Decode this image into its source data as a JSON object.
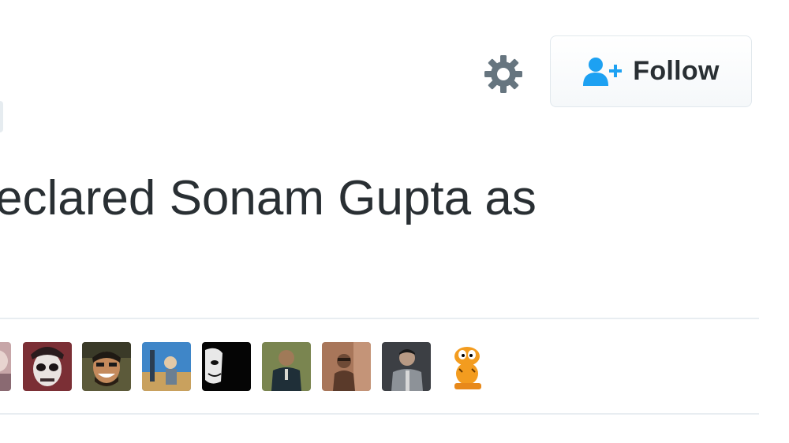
{
  "header": {
    "settings_icon": "gear-icon",
    "follow_button": {
      "label": "Follow",
      "icon": "user-follow-icon",
      "accent_color": "#1da1f2"
    }
  },
  "tweet": {
    "text": "eclared Sonam Gupta as"
  },
  "likers": {
    "avatars": [
      {
        "kind": "partial-avatar"
      },
      {
        "kind": "skull-face-avatar"
      },
      {
        "kind": "smiling-man-avatar"
      },
      {
        "kind": "outdoor-photo-avatar"
      },
      {
        "kind": "dark-joker-avatar"
      },
      {
        "kind": "man-in-suit-avatar"
      },
      {
        "kind": "sepia-man-avatar"
      },
      {
        "kind": "man-grey-jacket-avatar"
      },
      {
        "kind": "garfield-cartoon-avatar"
      }
    ]
  }
}
